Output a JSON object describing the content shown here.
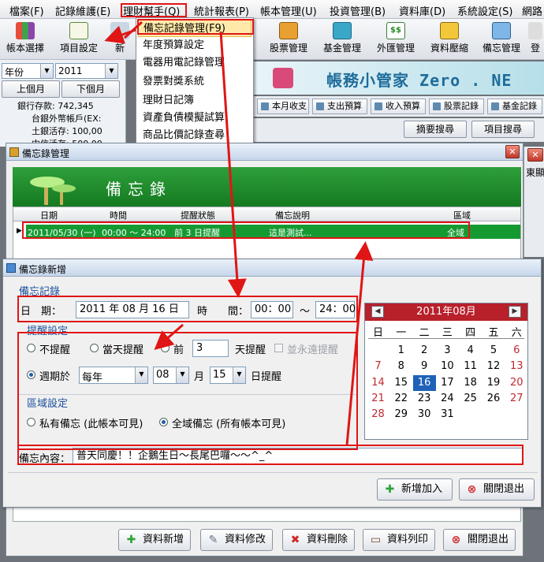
{
  "menubar": [
    "檔案(F)",
    "記錄維護(E)",
    "理財幫手(Q)",
    "統計報表(P)",
    "帳本管理(U)",
    "投資管理(B)",
    "資料庫(D)",
    "系統設定(S)",
    "網路"
  ],
  "toolbar": [
    "帳本選擇",
    "項目設定",
    "新",
    "股票管理",
    "基金管理",
    "外匯管理",
    "資料壓縮",
    "備忘管理",
    "登"
  ],
  "left": {
    "period": "年份",
    "year": "2011",
    "prev_month": "上個月",
    "next_month": "下個月",
    "tree": [
      "銀行存款: 742,345",
      "台銀外幣帳戶(EX:",
      "土銀活存: 100,00",
      "中信活存: 500,00"
    ]
  },
  "dropdown": [
    "備忘記錄管理(F9)",
    "年度預算設定",
    "電器用電記錄管理",
    "發票對獎系統",
    "理財日記簿",
    "資產負債模擬試算",
    "商品比價記錄查尋"
  ],
  "banner_title": "帳務小管家 Zero . NE",
  "tabs": [
    "本月收支",
    "支出預算",
    "收入預算",
    "股票記錄",
    "基金記錄"
  ],
  "search_buttons": [
    "摘要搜尋",
    "項目搜尋"
  ],
  "right_edge_label": "東顯",
  "memo_window": {
    "title": "備忘錄管理",
    "header": "備忘錄",
    "columns": [
      "日期",
      "時間",
      "提醒狀態",
      "備忘說明",
      "區域"
    ],
    "row": {
      "date": "2011/05/30 (一)",
      "time": "00:00 ～ 24:00",
      "status": "前 3 日提醒",
      "desc": "這是測試...",
      "area": "全域"
    },
    "buttons": [
      "資料新增",
      "資料修改",
      "資料刪除",
      "資料列印",
      "關閉退出"
    ]
  },
  "add_window": {
    "title": "備忘錄新增",
    "section_record": "備忘記錄",
    "date_label": "日　期：",
    "date_value": "2011 年 08 月 16 日",
    "time_label": "時　　間：",
    "time_start": "00：00",
    "tilde": "～",
    "time_end": "24：00",
    "section_remind": "提醒設定",
    "no_remind": "不提醒",
    "same_day": "當天提醒",
    "before": "前",
    "days_before": "3",
    "days_remind": "天提醒",
    "forever": "並永遠提醒",
    "periodic": "週期於",
    "period_sel": "每年",
    "month_sel": "08",
    "month_label": "月",
    "day_sel": "15",
    "day_remind": "日提醒",
    "section_area": "區域設定",
    "private": "私有備忘 (此帳本可見)",
    "global": "全域備忘 (所有帳本可見)",
    "content_label": "備忘內容：",
    "content_value": "普天同慶！！企鵝生日～長尾巴囉～～^_^",
    "add_button": "新增加入",
    "close_button": "關閉退出"
  },
  "calendar": {
    "title": "2011年08月",
    "dow": [
      "日",
      "一",
      "二",
      "三",
      "四",
      "五",
      "六"
    ],
    "selected": 16
  },
  "colors": {
    "annotation_red": "#e01515",
    "green_header": "#1b8a2a",
    "calendar_red": "#b8202a",
    "selected_day": "#1e62b8"
  }
}
